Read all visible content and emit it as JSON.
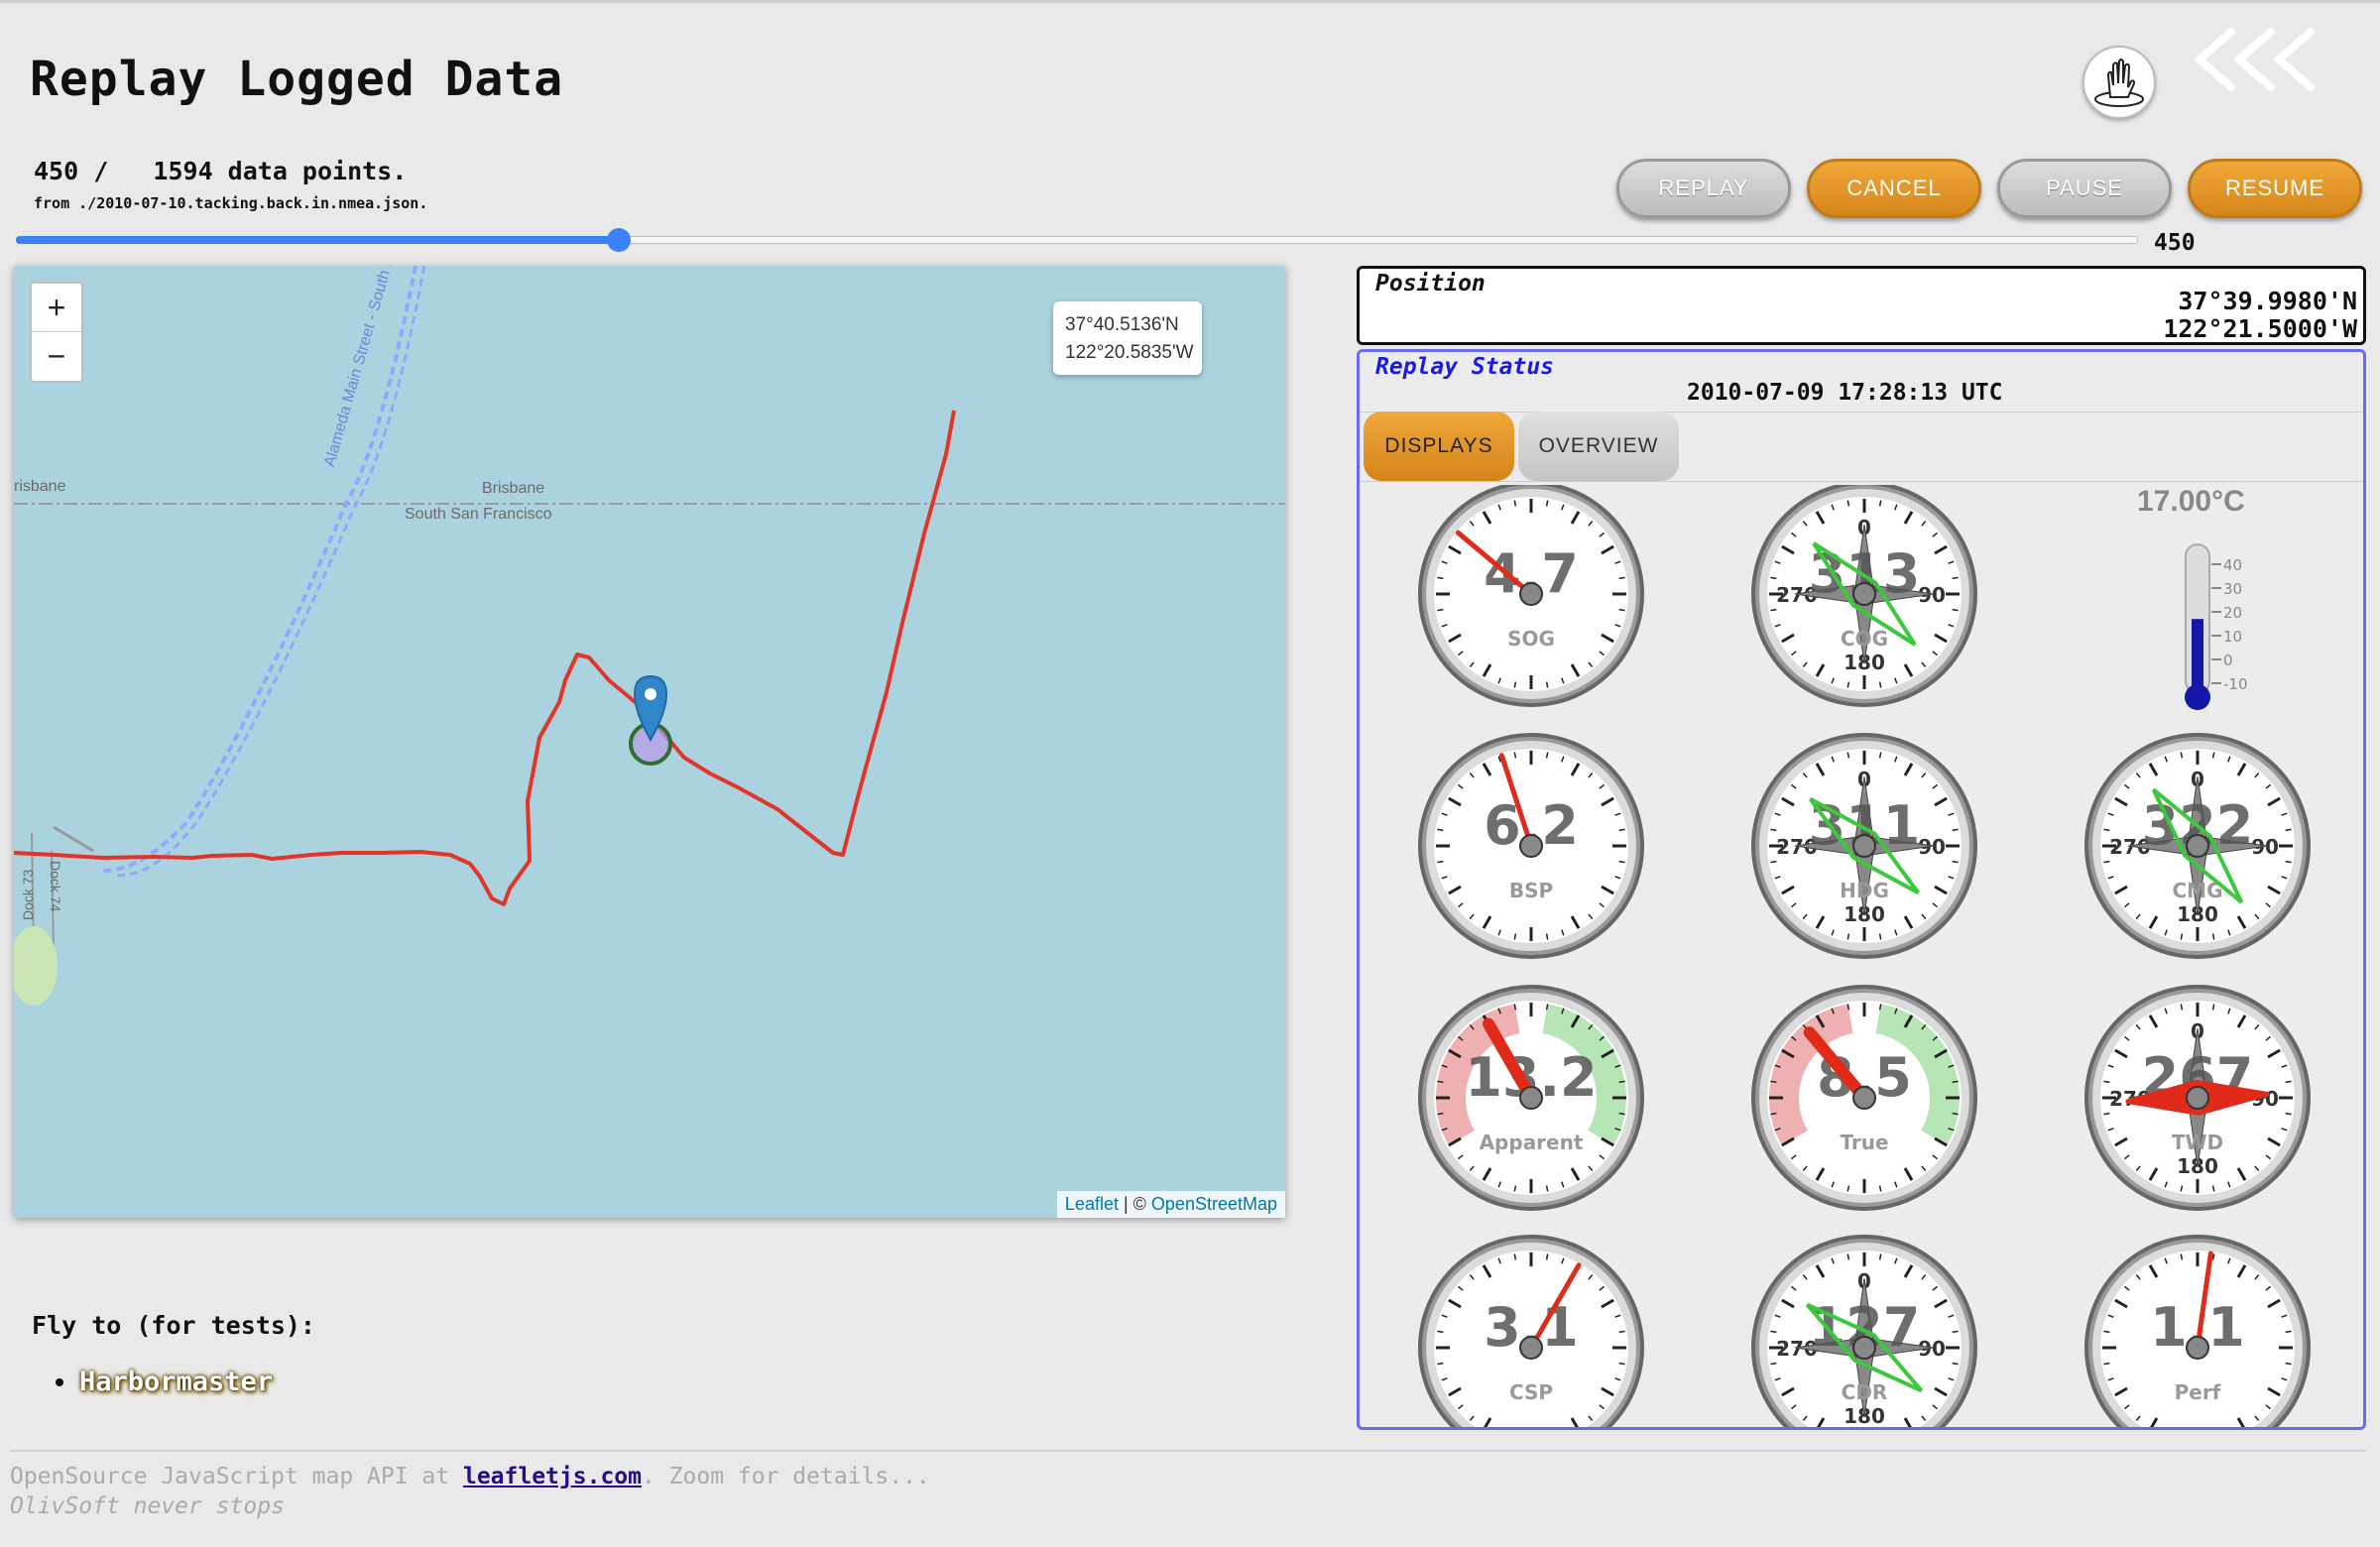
{
  "header": {
    "title": "Replay Logged Data"
  },
  "replay": {
    "counter": "450 /   1594 data points.",
    "source": "from ./2010-07-10.tacking.back.in.nmea.json.",
    "slider_value": "450",
    "progress_fraction": 0.282
  },
  "buttons": {
    "replay": "REPLAY",
    "cancel": "CANCEL",
    "pause": "PAUSE",
    "resume": "RESUME"
  },
  "map": {
    "zoom_in": "+",
    "zoom_out": "−",
    "popup_lat": "37°40.5136'N",
    "popup_lon": "122°20.5835'W",
    "attr_leaflet": "Leaflet",
    "attr_sep": " | © ",
    "attr_osm": "OpenStreetMap",
    "labels": {
      "brisbane_left": "risbane",
      "brisbane": "Brisbane",
      "ssf": "South San Francisco",
      "street": "Alameda Main Street - South Sa",
      "dock73": "Dock 73",
      "dock74": "Dock 74"
    }
  },
  "position": {
    "title": "Position",
    "lat": "37°39.9980'N",
    "lon": "122°21.5000'W"
  },
  "status": {
    "title": "Replay Status",
    "time": "2010-07-09 17:28:13 UTC",
    "tabs": [
      "DISPLAYS",
      "OVERVIEW"
    ]
  },
  "gauges": {
    "temperature": "17.00°C",
    "thermo_ticks": [
      "40",
      "30",
      "20",
      "10",
      "0",
      "-10"
    ],
    "thermo_level_c": 17,
    "items": [
      {
        "value": "4.7",
        "label": "SOG"
      },
      {
        "value": "313",
        "label": "COG"
      },
      {
        "value": "6.2",
        "label": "BSP"
      },
      {
        "value": "311",
        "label": "HDG"
      },
      {
        "value": "322",
        "label": "CMG"
      },
      {
        "value": "13.2",
        "label": "Apparent"
      },
      {
        "value": "8.5",
        "label": "True"
      },
      {
        "value": "267",
        "label": "TWD"
      },
      {
        "value": "3.1",
        "label": "CSP"
      },
      {
        "value": "127",
        "label": "CDR"
      },
      {
        "value": "1.1",
        "label": "Perf"
      }
    ]
  },
  "footer": {
    "flyto_title": "Fly to (for tests):",
    "flyto_item": "Harbormaster",
    "line1_pre": "OpenSource JavaScript map API at ",
    "line1_link": "leafletjs.com",
    "line1_post": ". Zoom for details...",
    "line2": "OlivSoft never stops"
  }
}
